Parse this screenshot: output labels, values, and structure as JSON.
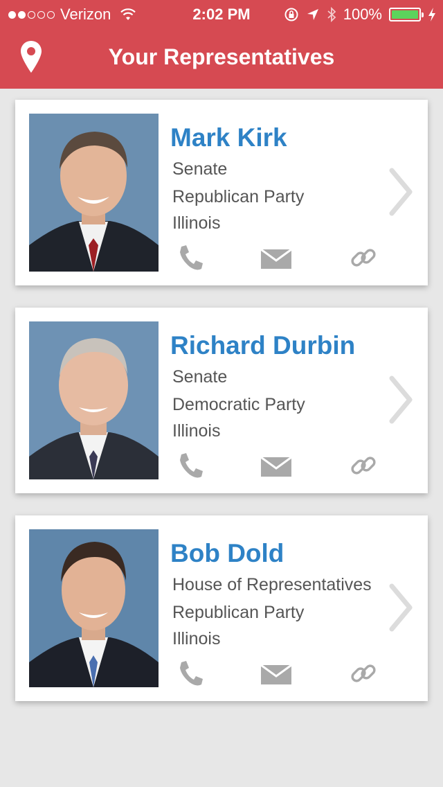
{
  "status_bar": {
    "carrier": "Verizon",
    "time": "2:02 PM",
    "battery": "100%"
  },
  "header": {
    "title": "Your Representatives"
  },
  "colors": {
    "header_bg": "#d64a52",
    "name_blue": "#2e82c6",
    "icon_gray": "#a9a9a9"
  },
  "representatives": [
    {
      "name": "Mark Kirk",
      "chamber": "Senate",
      "party": "Republican Party",
      "state": "Illinois"
    },
    {
      "name": "Richard Durbin",
      "chamber": "Senate",
      "party": "Democratic Party",
      "state": "Illinois"
    },
    {
      "name": "Bob Dold",
      "chamber": "House of Representatives",
      "party": "Republican Party",
      "state": "Illinois"
    }
  ],
  "icons": [
    "location-pin-icon",
    "phone-icon",
    "mail-icon",
    "link-icon",
    "chevron-right-icon"
  ]
}
